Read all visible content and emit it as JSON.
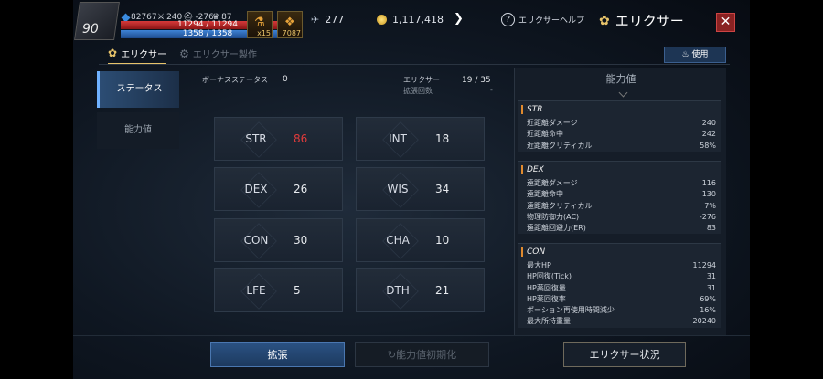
{
  "hud": {
    "level": "90",
    "gems": "82767",
    "stat_a": "240",
    "stat_b": "-276",
    "stat_c": "87",
    "hp": "11294 / 11294",
    "mp": "1358 / 1358",
    "item1_count": "x15",
    "item2_count": "7087",
    "feathers": "277",
    "gold": "1,117,418"
  },
  "header": {
    "help_label": "エリクサーヘルプ",
    "title": "エリクサー",
    "close": "✕"
  },
  "tabs": [
    {
      "label": "エリクサー",
      "active": true
    },
    {
      "label": "エリクサー製作",
      "active": false
    }
  ],
  "use_button": "使用",
  "sidebar": [
    {
      "label": "ステータス",
      "active": true
    },
    {
      "label": "能力値",
      "active": false
    }
  ],
  "info": {
    "bonus_label": "ボーナスステータス",
    "bonus_value": "0",
    "elixir_label": "エリクサー",
    "elixir_sub": "拡張回数",
    "elixir_value": "19 / 35",
    "dash": "-"
  },
  "stats": [
    {
      "name": "STR",
      "value": "86",
      "highlight": true
    },
    {
      "name": "INT",
      "value": "18"
    },
    {
      "name": "DEX",
      "value": "26"
    },
    {
      "name": "WIS",
      "value": "34"
    },
    {
      "name": "CON",
      "value": "30"
    },
    {
      "name": "CHA",
      "value": "10"
    },
    {
      "name": "LFE",
      "value": "5"
    },
    {
      "name": "DTH",
      "value": "21"
    }
  ],
  "panel": {
    "title": "能力値",
    "groups": [
      {
        "name": "STR",
        "rows": [
          {
            "label": "近距離ダメージ",
            "value": "240"
          },
          {
            "label": "近距離命中",
            "value": "242"
          },
          {
            "label": "近距離クリティカル",
            "value": "58%"
          }
        ]
      },
      {
        "name": "DEX",
        "rows": [
          {
            "label": "遠距離ダメージ",
            "value": "116"
          },
          {
            "label": "遠距離命中",
            "value": "130"
          },
          {
            "label": "遠距離クリティカル",
            "value": "7%"
          },
          {
            "label": "物理防御力(AC)",
            "value": "-276"
          },
          {
            "label": "遠距離回避力(ER)",
            "value": "83"
          }
        ]
      },
      {
        "name": "CON",
        "rows": [
          {
            "label": "最大HP",
            "value": "11294"
          },
          {
            "label": "HP回復(Tick)",
            "value": "31"
          },
          {
            "label": "HP薬回復量",
            "value": "31"
          },
          {
            "label": "HP薬回復率",
            "value": "69%"
          },
          {
            "label": "ポーション再使用時間減少",
            "value": "16%"
          },
          {
            "label": "最大所持重量",
            "value": "20240"
          }
        ]
      }
    ]
  },
  "buttons": {
    "expand": "拡張",
    "reset": "能力値初期化",
    "status": "エリクサー状況"
  },
  "colors": {
    "accent": "#e7c36a",
    "primary_button": "#2a5182",
    "highlight_value": "#e03b3b",
    "close_button": "#8a2222"
  }
}
